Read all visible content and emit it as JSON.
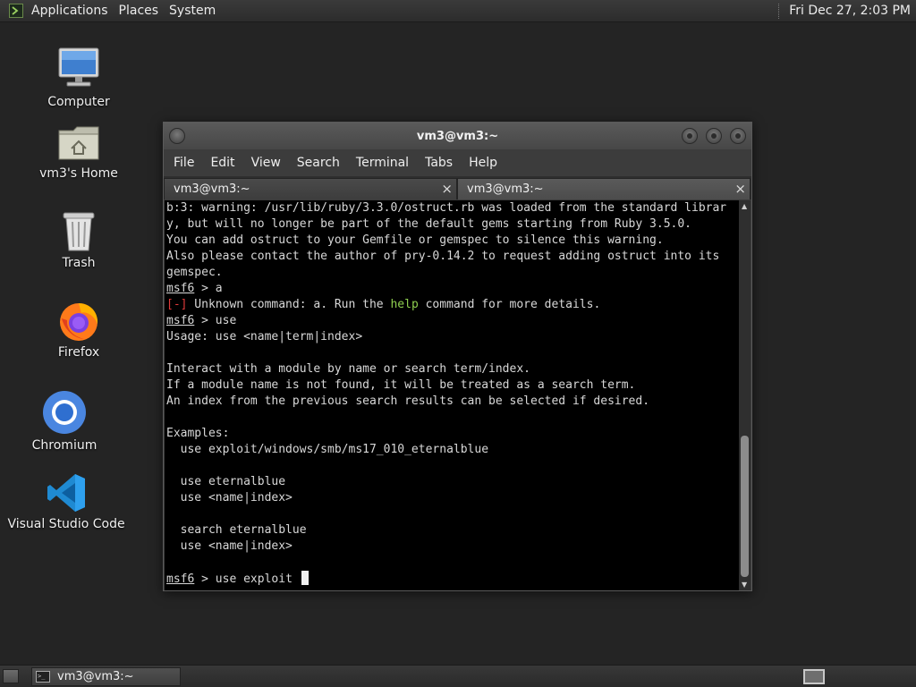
{
  "top_panel": {
    "menus": [
      "Applications",
      "Places",
      "System"
    ],
    "clock": "Fri Dec 27,  2:03 PM"
  },
  "desktop_icons": [
    {
      "label": "Computer",
      "icon": "computer-icon"
    },
    {
      "label": "vm3's Home",
      "icon": "home-folder-icon"
    },
    {
      "label": "Trash",
      "icon": "trash-icon"
    },
    {
      "label": "Firefox",
      "icon": "firefox-icon"
    },
    {
      "label": "Chromium",
      "icon": "chromium-icon"
    },
    {
      "label": "Visual Studio Code",
      "icon": "vscode-icon"
    }
  ],
  "window": {
    "title": "vm3@vm3:~",
    "menus": [
      "File",
      "Edit",
      "View",
      "Search",
      "Terminal",
      "Tabs",
      "Help"
    ],
    "tabs": [
      {
        "label": "vm3@vm3:~",
        "close": "×"
      },
      {
        "label": "vm3@vm3:~",
        "close": "×"
      }
    ]
  },
  "terminal": {
    "prompt": "msf6",
    "prompt_suffix": " > ",
    "lines": {
      "l1": "b:3: warning: /usr/lib/ruby/3.3.0/ostruct.rb was loaded from the standard librar",
      "l2": "y, but will no longer be part of the default gems starting from Ruby 3.5.0.",
      "l3": "You can add ostruct to your Gemfile or gemspec to silence this warning.",
      "l4": "Also please contact the author of pry-0.14.2 to request adding ostruct into its",
      "l5": "gemspec.",
      "cmd1": "a",
      "err_tag": "[-]",
      "err_a": " Unknown command: a. Run the ",
      "err_help": "help",
      "err_b": " command for more details.",
      "cmd2": "use",
      "usage": "Usage: use <name|term|index>",
      "i1": "Interact with a module by name or search term/index.",
      "i2": "If a module name is not found, it will be treated as a search term.",
      "i3": "An index from the previous search results can be selected if desired.",
      "ex": "Examples:",
      "e1": "  use exploit/windows/smb/ms17_010_eternalblue",
      "e2": "  use eternalblue",
      "e3": "  use <name|index>",
      "e4": "  search eternalblue",
      "e5": "  use <name|index>",
      "cmd3": "use exploit "
    }
  },
  "taskbar": {
    "task_label": "vm3@vm3:~",
    "task_icon_text": ">_"
  },
  "colors": {
    "error": "#e03a3a",
    "help_highlight": "#8fcf4f",
    "terminal_bg": "#000000"
  }
}
